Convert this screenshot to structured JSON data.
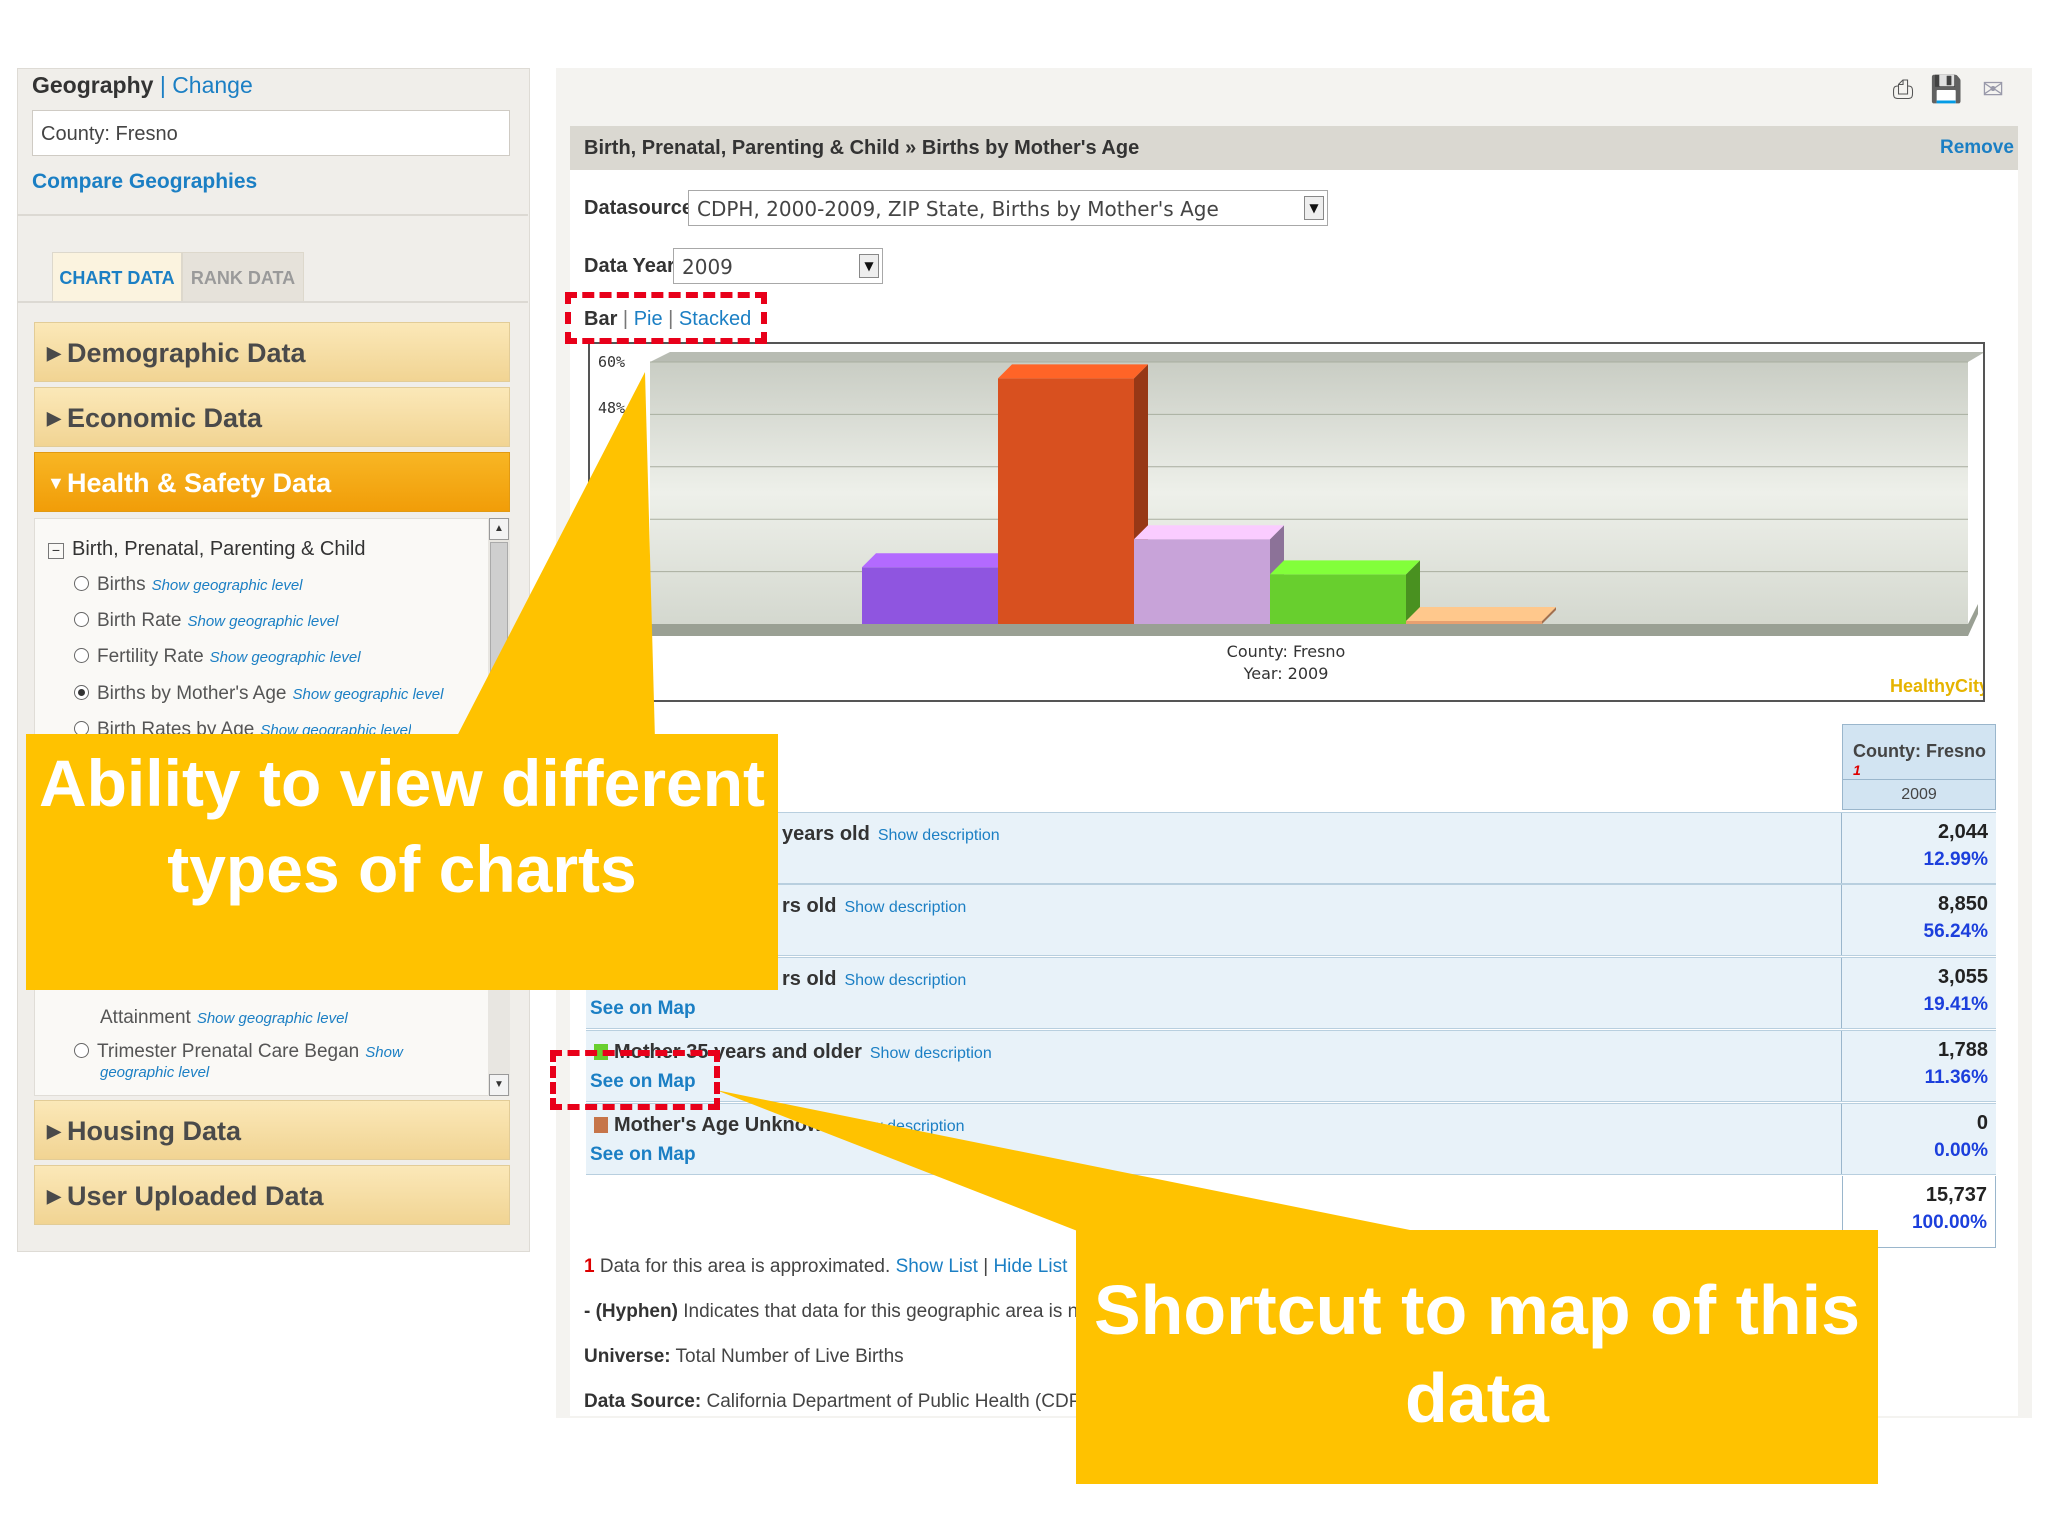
{
  "left": {
    "geography_label": "Geography",
    "separator": "|",
    "change_link": "Change",
    "geography_value": "County: Fresno",
    "compare_link": "Compare Geographies",
    "tabs": [
      "CHART DATA",
      "RANK DATA"
    ],
    "accordion": [
      "Demographic Data",
      "Economic Data",
      "Health & Safety Data",
      "Housing Data",
      "User Uploaded Data"
    ],
    "tree_parent": "Birth, Prenatal, Parenting & Child",
    "show_geo": "Show geographic level",
    "tree_items": [
      "Births",
      "Birth Rate",
      "Fertility Rate",
      "Births by Mother's Age",
      "Birth Rates by Age"
    ],
    "partial_item": "Attainment",
    "trimester_item": "Trimester Prenatal Care Began",
    "trimester_show": "Show",
    "trimester_geo": "geographic level"
  },
  "main": {
    "breadcrumb": "Birth, Prenatal, Parenting & Child » Births by Mother's Age",
    "remove": "Remove",
    "datasource_label": "Datasource",
    "datasource_value": "CDPH, 2000-2009, ZIP State, Births by Mother's Age",
    "datayear_label": "Data Year",
    "datayear_value": "2009",
    "chart_type_bar": "Bar",
    "chart_type_pie": "Pie",
    "chart_type_stacked": "Stacked",
    "sep": "|",
    "chart_caption_1": "County: Fresno",
    "chart_caption_2": "Year: 2009",
    "watermark": "HealthyCity"
  },
  "chart_data": {
    "type": "bar",
    "categories": [
      "years old",
      "rs old",
      "rs old",
      "Mother 35 years and older",
      "Mother's Age Unknown"
    ],
    "values": [
      12.99,
      56.24,
      19.41,
      11.36,
      0.0
    ],
    "colors": [
      "#8f55e0",
      "#d8501f",
      "#c8a3d9",
      "#68cf2e",
      "#e8a070"
    ],
    "ylim": [
      0,
      60
    ],
    "y_ticks": [
      "60%",
      "48%"
    ]
  },
  "table": {
    "col_header": "County: Fresno",
    "footnote_mark": "1",
    "col_year": "2009",
    "show_description": "Show description",
    "see_on_map": "See on Map",
    "rows": [
      {
        "label": "years old",
        "count": "2,044",
        "pct": "12.99%"
      },
      {
        "label": "rs old",
        "count": "8,850",
        "pct": "56.24%"
      },
      {
        "label": "rs old",
        "count": "3,055",
        "pct": "19.41%"
      },
      {
        "label": "Mother 35 years and older",
        "count": "1,788",
        "pct": "11.36%"
      },
      {
        "label": "Mother's Age Unknown",
        "count": "0",
        "pct": "0.00%"
      }
    ],
    "total_count": "15,737",
    "total_pct": "100.00%"
  },
  "notes": {
    "n1_num": "1",
    "n1_text": "Data for this area is approximated.",
    "n1_show": "Show List",
    "n1_hide": "Hide List",
    "n2_bold": "- (Hyphen)",
    "n2_text": "Indicates that data for this geographic area is not a",
    "universe_label": "Universe:",
    "universe_text": "Total Number of Live Births",
    "source_label": "Data Source:",
    "source_text": "California Department of Public Health (CDPH)"
  },
  "callouts": {
    "left": "Ability to view different types of charts",
    "right": "Shortcut to map of this data",
    "color": "#ffc200",
    "dash_color": "#e8001a"
  }
}
